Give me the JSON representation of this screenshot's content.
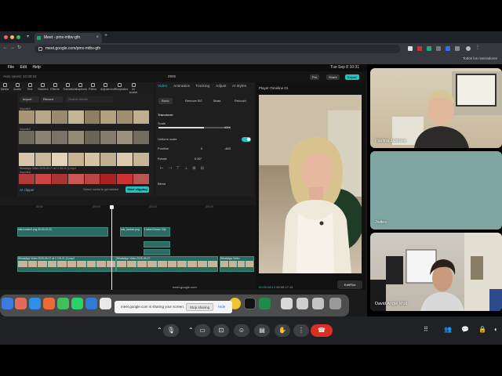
{
  "browser": {
    "tab_title": "Meet - pmx-mtbv-gfn",
    "url": "meet.google.com/pmx-mtbv-gfn",
    "bookmarks_label": "Todos los marcadores"
  },
  "mac_menubar": {
    "items": [
      "File",
      "Edit",
      "Help"
    ],
    "clock": "Tue Sep 8  10:31"
  },
  "capcut": {
    "autosave": "Auto saved: 10:30:16",
    "project_title": "0905",
    "pro_label": "Pro",
    "share_label": "Share",
    "export_label": "Export",
    "media_tools": [
      "Media",
      "Audio",
      "Text",
      "Stickers",
      "Effects",
      "Transitions",
      "Captions",
      "Filters",
      "Adjustment",
      "Templates",
      "AI avatar"
    ],
    "import_label": "Import",
    "record_label": "Record",
    "search_placeholder": "Search media",
    "media_rows": [
      {
        "caption": "Imported"
      },
      {
        "caption": "Imported"
      },
      {
        "caption": "WhatsApp Video 2025-09-07 at 17.05.21 (1).mp4"
      },
      {
        "caption": "Imported"
      }
    ],
    "ai_clipper_label": "AI clipper",
    "ai_clipper_hint": "Select media to get started",
    "start_clipping": "Start clipping",
    "inspector_tabs": [
      "Video",
      "Animation",
      "Tracking",
      "Adjust",
      "AI styles"
    ],
    "inspector_subtabs": [
      "Basic",
      "Remove BG",
      "Mask",
      "Retouch"
    ],
    "transform_label": "Transform",
    "scale_label": "Scale",
    "scale_value": "63%",
    "scale_fraction": 0.63,
    "uniform_scale_label": "Uniform scale",
    "position_label": "Position",
    "position_x": "0",
    "position_y": "-463",
    "rotate_label": "Rotate",
    "rotate_value": "0.00°",
    "blend_label": "Blend",
    "player_title": "Player-Timeline 01",
    "timecode": "00:00:08:13",
    "duration": "00:00:17:13",
    "editpilot_label": "EditPilot",
    "ruler_marks": [
      "00:00",
      "|00:03",
      "|00:10",
      "|00:20"
    ],
    "track_labels": {
      "audio_a": "ads1content.png  00:00:10:23",
      "audio_b": "ads_banner.png",
      "audio_c": "Locked Bonus Clip",
      "video_main": "WhatsApp Video 2025-09-07 at 17.05.21 (1).mp4",
      "video_b": "WhatsApp Video 2025-09-07",
      "video_c": "WhatsApp Video"
    }
  },
  "screen_share": {
    "message": "meet.google.com is sharing your screen.",
    "stop_label": "Stop sharing",
    "hide_label": "Hide",
    "url_tooltip": "meet.google.com"
  },
  "participants": [
    {
      "name": "Pavlina Jaskova"
    },
    {
      "name": "Jwiles"
    },
    {
      "name": "David Angel Moli"
    }
  ],
  "colors": {
    "accent": "#25c2c2",
    "end_call": "#d93025",
    "meet_bg": "#202124"
  },
  "icons": [
    "mic-icon",
    "camera-icon",
    "present-icon",
    "emoji-icon",
    "captions-icon",
    "raise-hand-icon",
    "more-icon",
    "end-call-icon",
    "apps-icon",
    "people-icon",
    "chat-icon",
    "activities-icon",
    "lock-icon"
  ]
}
